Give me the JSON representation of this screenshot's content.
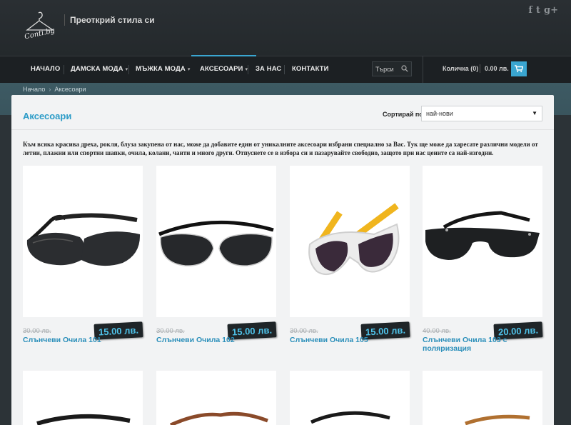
{
  "brand": {
    "tagline": "Преоткрий стила си",
    "logo_text": "Conti.bg"
  },
  "social": [
    "f",
    "t",
    "g+"
  ],
  "nav": {
    "items": [
      {
        "label": "НАЧАЛО",
        "caret": ""
      },
      {
        "label": "ДАМСКА МОДА",
        "caret": "▾"
      },
      {
        "label": "МЪЖКА МОДА",
        "caret": "▾"
      },
      {
        "label": "АКСЕСОАРИ",
        "caret": "▾"
      },
      {
        "label": "ЗА НАС",
        "caret": ""
      },
      {
        "label": "КОНТАКТИ",
        "caret": ""
      }
    ],
    "active_index": 3,
    "search_placeholder": "Търси"
  },
  "cart": {
    "label": "Количка (0)",
    "amount": "0.00 лв."
  },
  "breadcrumb": {
    "home": "Начало",
    "separator": "›",
    "current": "Аксесоари"
  },
  "page": {
    "title": "Аксесоари",
    "sort_label": "Сортирай по:",
    "sort_value": "най-нови",
    "intro": "Към всяка красива дреха, рокля, блуза закупена от нас, може да добавите един от уникалните аксесоари избрани специално за Вас. Тук ще може да харесате различни модели от летни,  плажни или спортни шапки, очила, колани, чанти и много други. Отпуснете се в избора си и пазарувайте свободно, защото при нас цените са най-изгодни."
  },
  "products": [
    {
      "name": "Слънчеви Очила 101",
      "old_price": "30.00 лв.",
      "price": "15.00 лв.",
      "frame": "#1a1a1a",
      "lens": "#2b2d30"
    },
    {
      "name": "Слънчеви Очила 102",
      "old_price": "30.00 лв.",
      "price": "15.00 лв.",
      "frame": "#111111",
      "lens": "#26282b"
    },
    {
      "name": "Слънчеви Очила 105",
      "old_price": "30.00 лв.",
      "price": "15.00 лв.",
      "frame": "#f0b51e",
      "lens": "#3a2a3a"
    },
    {
      "name": "Слънчеви Очила 103 с поляризация",
      "old_price": "40.00 лв.",
      "price": "20.00 лв.",
      "frame": "#151515",
      "lens": "#1e2022"
    }
  ],
  "colors": {
    "accent": "#3aa6d1",
    "title_blue": "#2b9bc7",
    "price_text": "#4fc3ea",
    "price_bg": "#1f2528"
  }
}
